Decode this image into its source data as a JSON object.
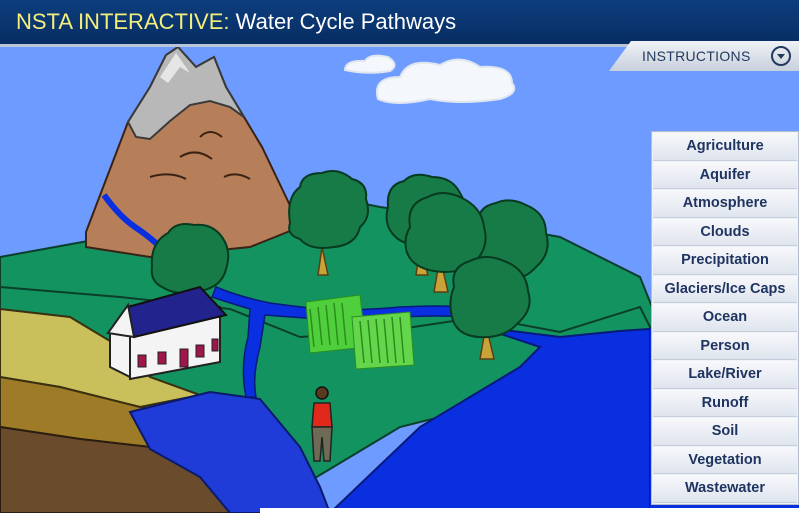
{
  "header": {
    "brand": "NSTA INTERACTIVE",
    "separator": ":",
    "title": " Water Cycle Pathways"
  },
  "instructions": {
    "label": "INSTRUCTIONS",
    "icon": "chevron-down-circle-icon"
  },
  "menu": {
    "items": [
      "Agriculture",
      "Aquifer",
      "Atmosphere",
      "Clouds",
      "Precipitation",
      "Glaciers/Ice Caps",
      "Ocean",
      "Person",
      "Lake/River",
      "Runoff",
      "Soil",
      "Vegetation",
      "Wastewater"
    ]
  },
  "colors": {
    "header": "#0d3e7e",
    "brand_text": "#f4ee7a",
    "sky": "#6d9bff",
    "grass": "#129460",
    "water": "#0a2fe0",
    "menu_text": "#1f3460"
  }
}
